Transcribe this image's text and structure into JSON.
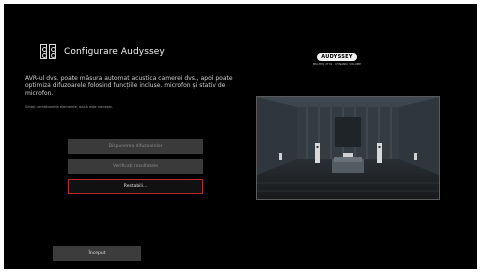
{
  "header": {
    "title": "Configurare Audyssey",
    "icon": "speakers-icon"
  },
  "logo": {
    "brand": "AUDYSSEY",
    "sub": "MULTEQ XT32 · DYNAMIC VOLUME"
  },
  "description": {
    "text": "AVR-ul dvs. poate măsura automat acustica camerei dvs., apoi poate optimiza difuzoarele folosind funcțiile incluse. microfon și stativ de microfon.",
    "hint": "Setați următoarele elemente, dacă este necesar."
  },
  "menu": {
    "items": [
      {
        "label": "Dispunerea difuzoarelor",
        "state": "disabled"
      },
      {
        "label": "Verificați rezultatele",
        "state": "disabled"
      },
      {
        "label": "Restabili...",
        "state": "focused"
      }
    ]
  },
  "footer": {
    "start_label": "Început"
  },
  "colors": {
    "background": "#000000",
    "button_disabled": "#3a3a3a",
    "focus_border": "#b32b2b"
  }
}
